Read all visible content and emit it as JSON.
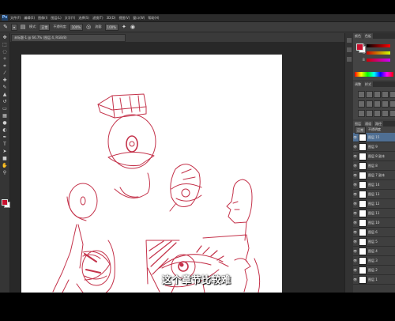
{
  "menubar": {
    "logo": "Ps",
    "items": [
      "文件(F)",
      "编辑(E)",
      "图像(I)",
      "图层(L)",
      "文字(Y)",
      "选择(S)",
      "滤镜(T)",
      "3D(D)",
      "视图(V)",
      "窗口(W)",
      "帮助(H)"
    ]
  },
  "options": {
    "mode_label": "模式:",
    "mode_value": "正常",
    "opacity_label": "不透明度:",
    "opacity_value": "100%",
    "flow_label": "流量:",
    "flow_value": "100%"
  },
  "document": {
    "tab_label": "未标题-1 @ 66.7% (图层 4, RGB/8)"
  },
  "colors": {
    "foreground": "#c8102e",
    "background": "#ffffff",
    "sketch_stroke": "#c4324a"
  },
  "panels": {
    "color_tabs": [
      "颜色",
      "色板"
    ],
    "adjust_tabs": [
      "调整",
      "样式"
    ],
    "layer_tabs": [
      "图层",
      "通道",
      "路径"
    ],
    "blend_mode": "正常",
    "opacity": "不透明度"
  },
  "layers": [
    {
      "name": "图层 15",
      "active": true
    },
    {
      "name": "图层 9"
    },
    {
      "name": "图层 8 副本"
    },
    {
      "name": "图层 8"
    },
    {
      "name": "图层 7 副本"
    },
    {
      "name": "图层 14"
    },
    {
      "name": "图层 13"
    },
    {
      "name": "图层 12"
    },
    {
      "name": "图层 11"
    },
    {
      "name": "图层 10"
    },
    {
      "name": "图层 6"
    },
    {
      "name": "图层 5"
    },
    {
      "name": "图层 4"
    },
    {
      "name": "图层 3"
    },
    {
      "name": "图层 2"
    },
    {
      "name": "图层 1"
    }
  ],
  "subtitle": "这个章节比较难"
}
